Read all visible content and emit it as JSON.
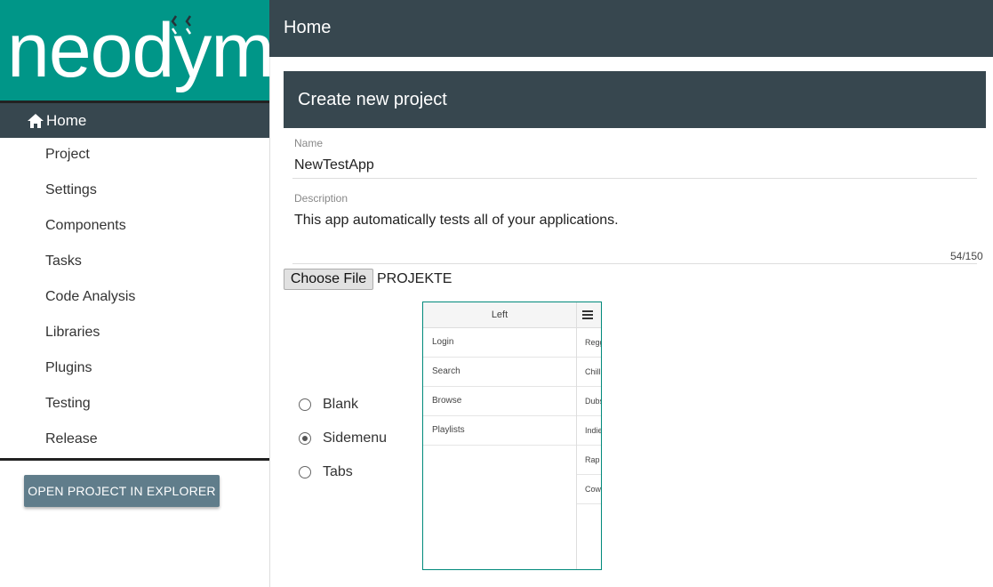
{
  "app": {
    "logo_text": "neodym",
    "brand_color": "#009688",
    "dark_color": "#37474f",
    "button_color": "#607d8b"
  },
  "sidebar": {
    "home": {
      "label": "Home",
      "icon": "home-icon"
    },
    "items": [
      {
        "label": "Project"
      },
      {
        "label": "Settings"
      },
      {
        "label": "Components"
      },
      {
        "label": "Tasks"
      },
      {
        "label": "Code Analysis"
      },
      {
        "label": "Libraries"
      },
      {
        "label": "Plugins"
      },
      {
        "label": "Testing"
      },
      {
        "label": "Release"
      }
    ],
    "open_button_label": "OPEN PROJECT IN EXPLORER"
  },
  "header": {
    "title": "Home"
  },
  "card": {
    "title": "Create new project",
    "name_label": "Name",
    "name_value": "NewTestApp",
    "description_label": "Description",
    "description_value": "This app automatically tests all of your applications.",
    "description_counter": "54/150",
    "choose_file_label": "Choose File",
    "file_name": "PROJEKTE"
  },
  "template": {
    "options": [
      {
        "label": "Blank",
        "selected": false
      },
      {
        "label": "Sidemenu",
        "selected": true
      },
      {
        "label": "Tabs",
        "selected": false
      }
    ],
    "preview": {
      "left_title": "Left",
      "left_items": [
        "Login",
        "Search",
        "Browse",
        "Playlists"
      ],
      "right_items": [
        "Reggae",
        "Chill",
        "Dubstep",
        "Indie",
        "Rap",
        "Cowbell"
      ]
    }
  }
}
